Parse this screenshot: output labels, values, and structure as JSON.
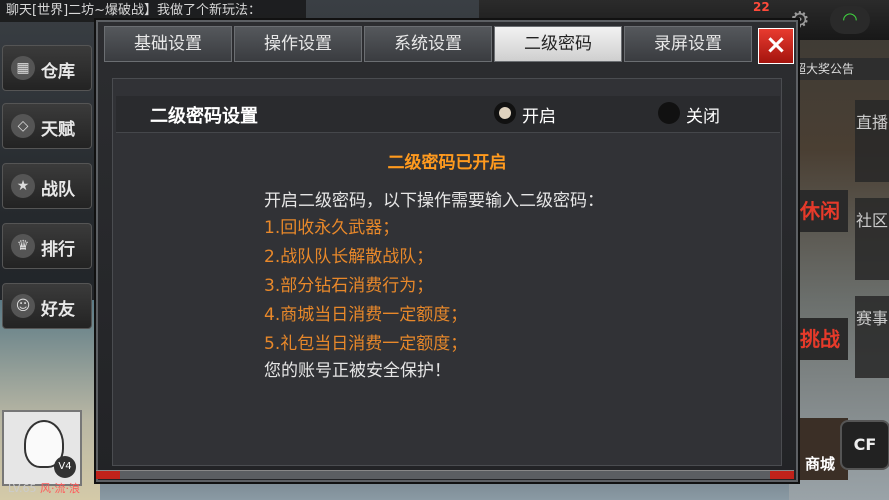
{
  "chat": {
    "text": "聊天[世界]二坊~爆破战】我做了个新玩法："
  },
  "notify": {
    "count": "22"
  },
  "left_menu": [
    "仓库",
    "天赋",
    "战队",
    "排行",
    "好友"
  ],
  "player": {
    "level": "LV.65",
    "name": "风·流·浪",
    "badge": "V4"
  },
  "right_menu": {
    "notice": "超大奖公告",
    "side_top": "直播",
    "side_mid": "社区",
    "side_bot": "赛事",
    "red1": "休闲",
    "red2": "挑战",
    "shop": "商城",
    "cf_logo": "CF"
  },
  "dialog": {
    "tabs": [
      "基础设置",
      "操作设置",
      "系统设置",
      "二级密码",
      "录屏设置"
    ],
    "active_tab": 3,
    "close_icon": "×",
    "setting_title": "二级密码设置",
    "option_on": "开启",
    "option_off": "关闭",
    "status": "二级密码已开启",
    "intro": "开启二级密码，以下操作需要输入二级密码：",
    "items": [
      "1.回收永久武器；",
      "2.战队队长解散战队；",
      "3.部分钻石消费行为；",
      "4.商城当日消费一定额度；",
      "5.礼包当日消费一定额度；"
    ],
    "footer": "您的账号正被安全保护！"
  },
  "colors": {
    "accent_orange": "#e8882a",
    "status_orange": "#ff9a1e",
    "close_red": "#d62a20"
  }
}
